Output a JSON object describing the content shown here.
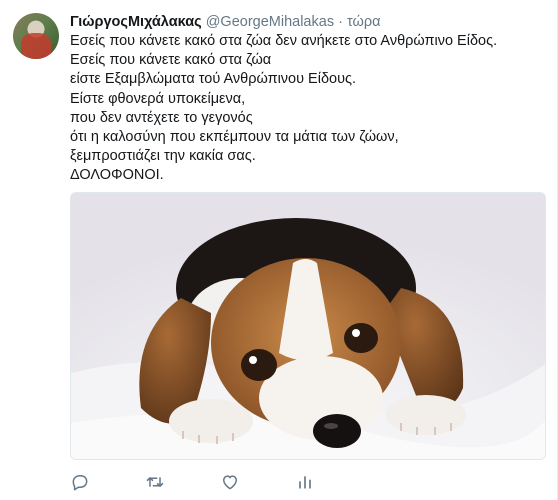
{
  "tweet": {
    "author_name": "ΓιώργοςΜιχάλακας",
    "handle": "@GeorgeMihalakas",
    "separator": "·",
    "time": "τώρα",
    "lines": [
      "Εσείς που κάνετε κακό στα ζώα δεν ανήκετε στο Ανθρώπινο Είδος.",
      "Εσείς που κάνετε κακό στα ζώα",
      "είστε Εξαμβλώματα τού Ανθρώπινου Είδους.",
      "Είστε φθονερά υποκείμενα,",
      "που δεν αντέχετε το γεγονός",
      "ότι η καλοσύνη που εκπέμπουν τα μάτια των ζώων,",
      "ξεμπροστιάζει την κακία σας.",
      "ΔΟΛΟΦΟΝΟΙ."
    ]
  },
  "actions": {
    "icons": [
      "reply-icon",
      "retweet-icon",
      "like-icon",
      "analytics-icon"
    ]
  },
  "colors": {
    "text": "#14171a",
    "secondary": "#657786",
    "border": "#e1e8ed"
  }
}
